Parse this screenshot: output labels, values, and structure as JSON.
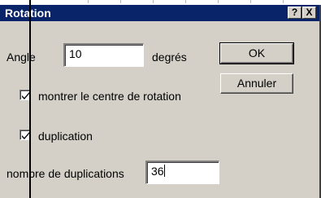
{
  "dialog": {
    "title": "Rotation",
    "help_label": "?",
    "close_label": "X",
    "angle_label": "Angle",
    "angle_value": "10",
    "angle_unit": "degrés",
    "ok_label": "OK",
    "cancel_label": "Annuler",
    "show_center_label": "montrer le centre de rotation",
    "show_center_checked": true,
    "duplicate_label": "duplication",
    "duplicate_checked": true,
    "dup_count_label": "nombre de duplications",
    "dup_count_value": "36"
  },
  "colors": {
    "titlebar": "#0a246a",
    "face": "#d4d0c8"
  }
}
